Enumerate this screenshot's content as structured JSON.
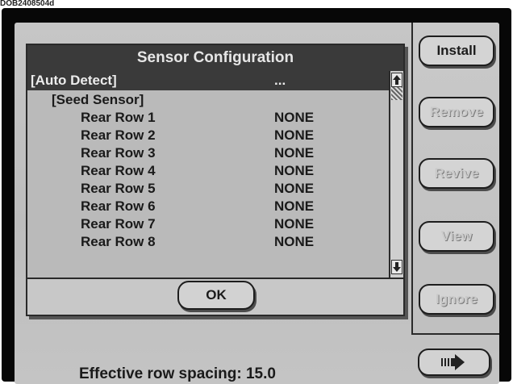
{
  "header_text": "DOB2408504d",
  "dialog": {
    "title": "Sensor Configuration",
    "ok_label": "OK"
  },
  "list": {
    "items": [
      {
        "label": "[Auto Detect]",
        "value": "...",
        "selected": true
      },
      {
        "label": "[Seed Sensor]",
        "value": ""
      },
      {
        "label": "Rear Row 1",
        "value": "NONE"
      },
      {
        "label": "Rear Row 2",
        "value": "NONE"
      },
      {
        "label": "Rear Row 3",
        "value": "NONE"
      },
      {
        "label": "Rear Row 4",
        "value": "NONE"
      },
      {
        "label": "Rear Row 5",
        "value": "NONE"
      },
      {
        "label": "Rear Row 6",
        "value": "NONE"
      },
      {
        "label": "Rear Row 7",
        "value": "NONE"
      },
      {
        "label": "Rear Row 8",
        "value": "NONE"
      }
    ]
  },
  "side_buttons": [
    {
      "label": "Install",
      "enabled": true
    },
    {
      "label": "Remove",
      "enabled": false
    },
    {
      "label": "Revive",
      "enabled": false
    },
    {
      "label": "View",
      "enabled": false
    },
    {
      "label": "Ignore",
      "enabled": false
    }
  ],
  "footer": {
    "spacing_text": "Effective row spacing: 15.0",
    "next_icon": "next-page-icon"
  },
  "colors": {
    "title_bar": "#3a3a3a",
    "screen_bg": "#c2c2c2",
    "bezel": "#070707",
    "disabled_text": "#c9c9c9"
  }
}
